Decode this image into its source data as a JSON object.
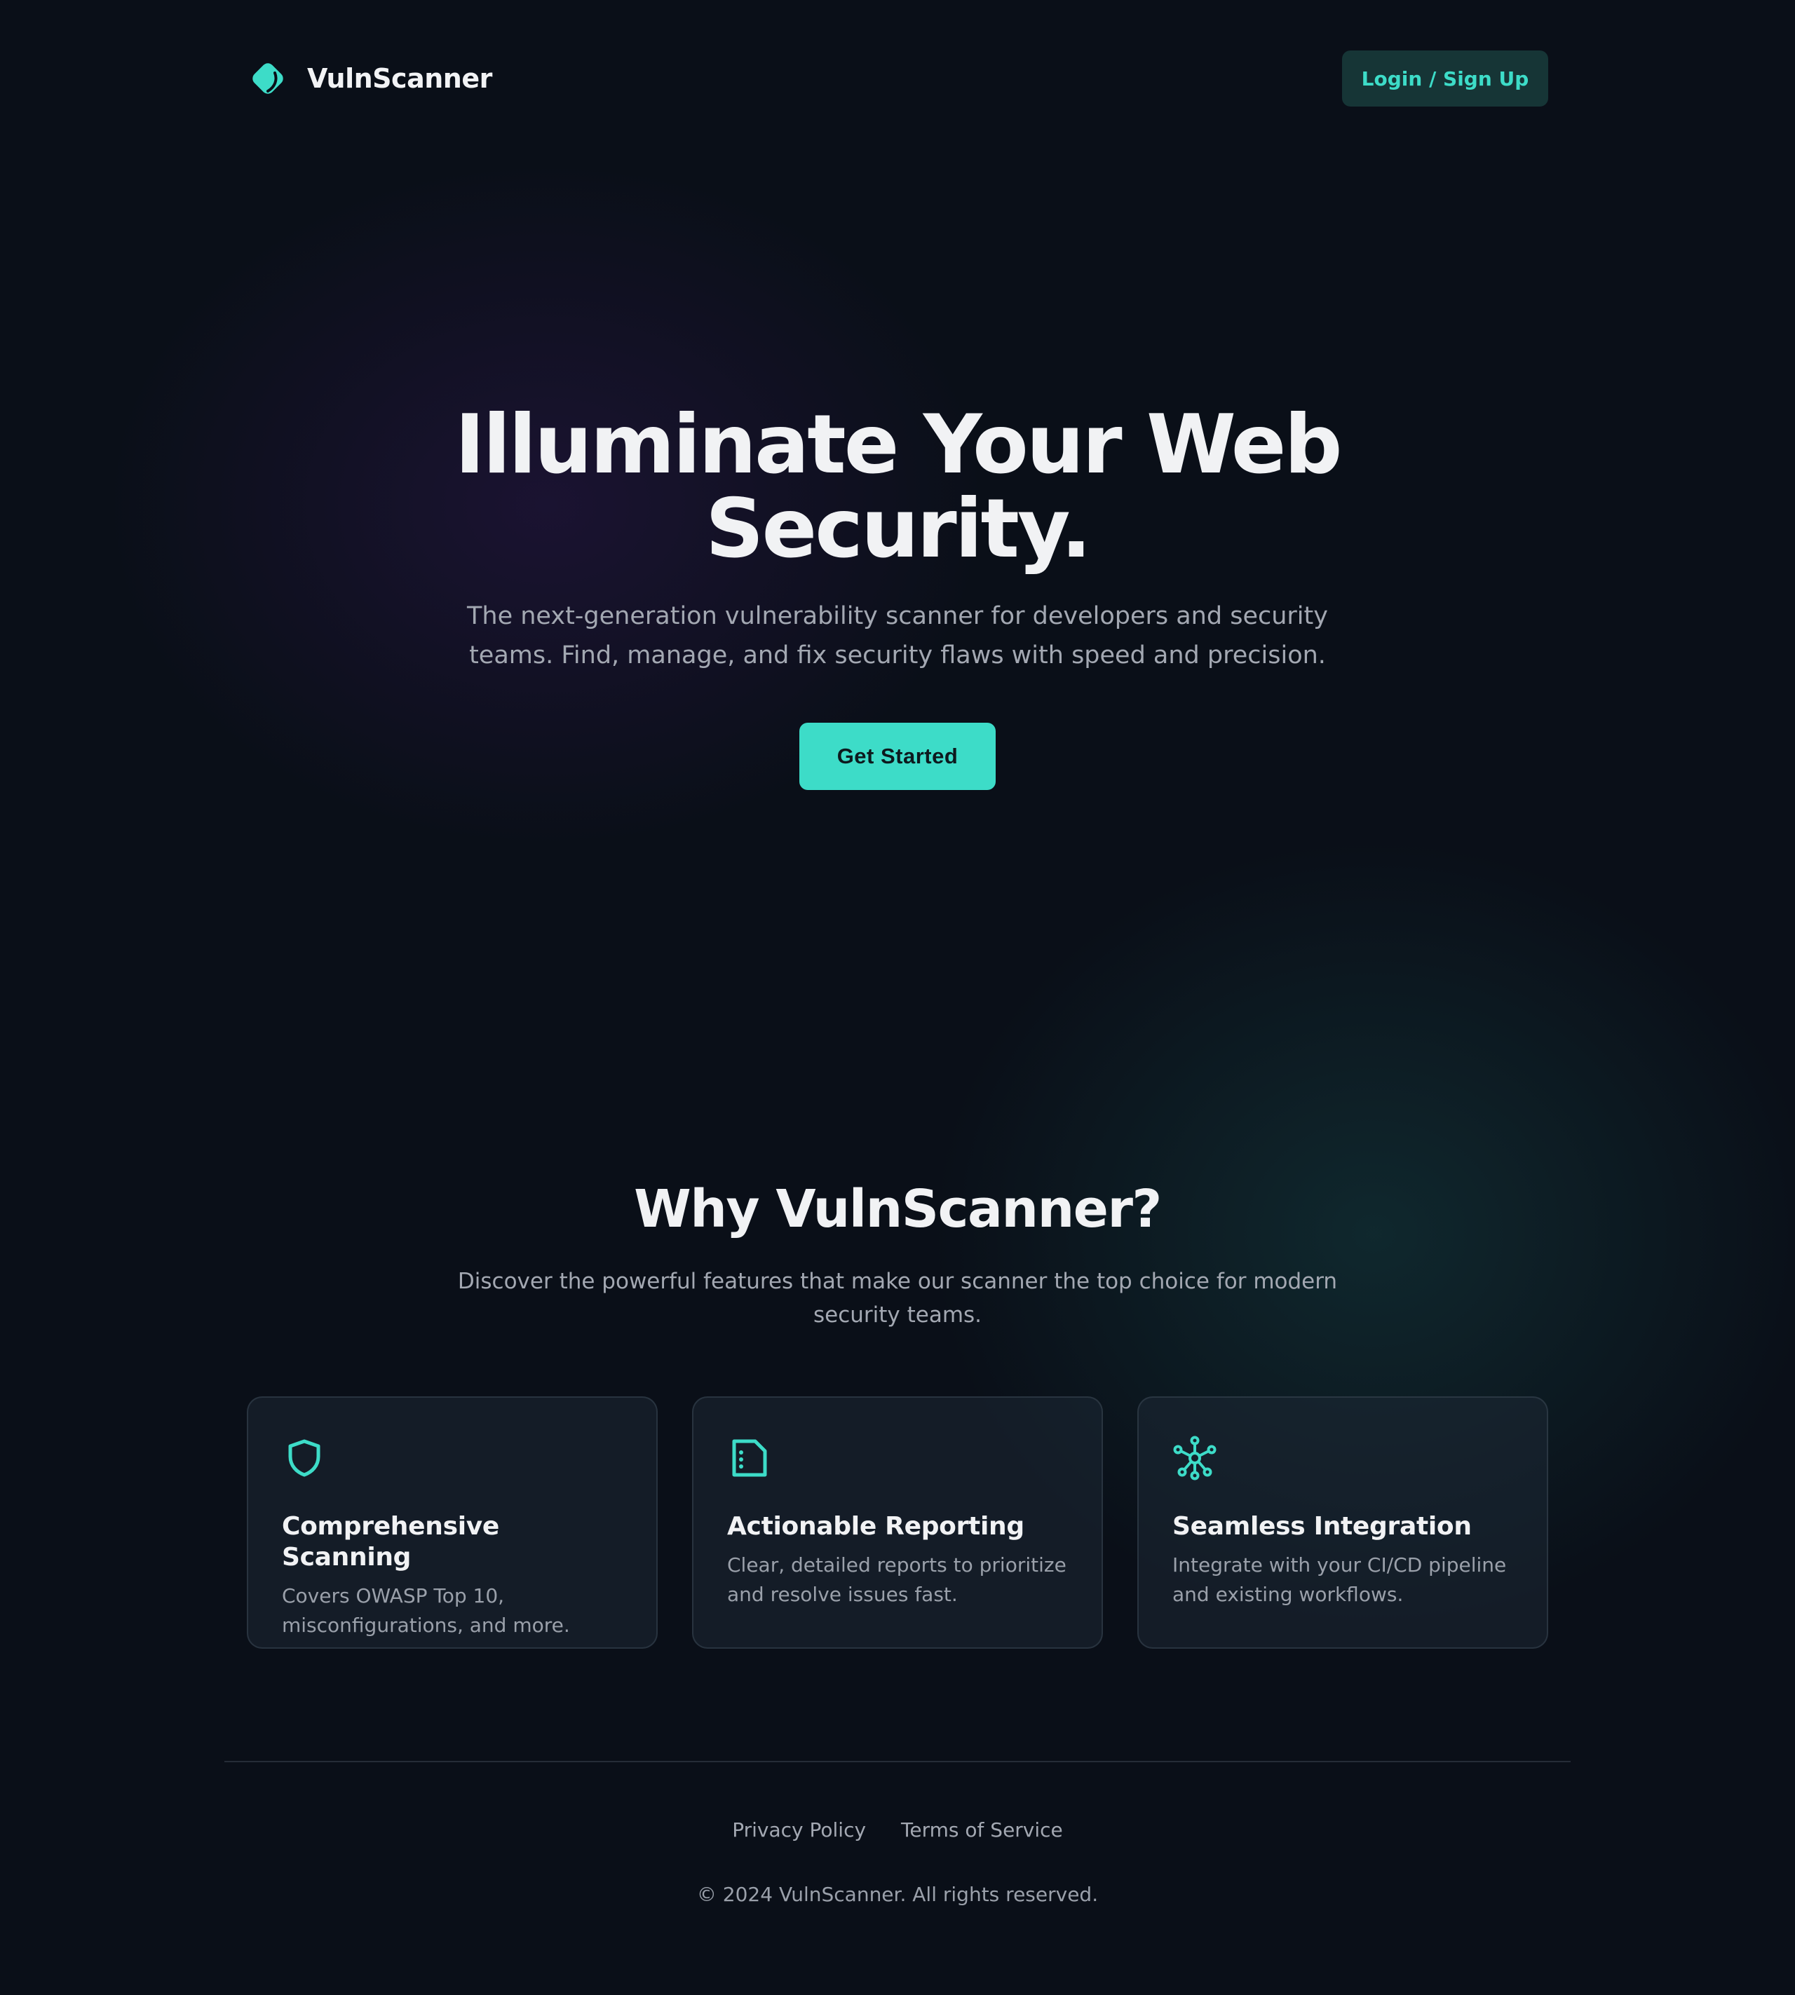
{
  "brand": {
    "name": "VulnScanner",
    "logo_icon": "tag-diamond-icon"
  },
  "header": {
    "login_label": "Login / Sign Up"
  },
  "hero": {
    "title": "Illuminate Your Web Security.",
    "subtitle": "The next-generation vulnerability scanner for developers and security teams. Find, manage, and fix security flaws with speed and precision.",
    "cta_label": "Get Started"
  },
  "why": {
    "title": "Why VulnScanner?",
    "subtitle": "Discover the powerful features that make our scanner the top choice for modern security teams."
  },
  "features": [
    {
      "icon": "shield-icon",
      "title": "Comprehensive Scanning",
      "description": "Covers OWASP Top 10, misconfigurations, and more."
    },
    {
      "icon": "report-document-icon",
      "title": "Actionable Reporting",
      "description": "Clear, detailed reports to prioritize and resolve issues fast."
    },
    {
      "icon": "network-hub-icon",
      "title": "Seamless Integration",
      "description": "Integrate with your CI/CD pipeline and existing workflows."
    }
  ],
  "footer": {
    "links": [
      "Privacy Policy",
      "Terms of Service"
    ],
    "copyright": "© 2024 VulnScanner. All rights reserved."
  },
  "colors": {
    "background": "#0a0f18",
    "accent": "#3ddcc8",
    "login_button_bg": "#163536",
    "text_primary": "#f1f2f4",
    "text_muted": "#a3a8b2"
  }
}
